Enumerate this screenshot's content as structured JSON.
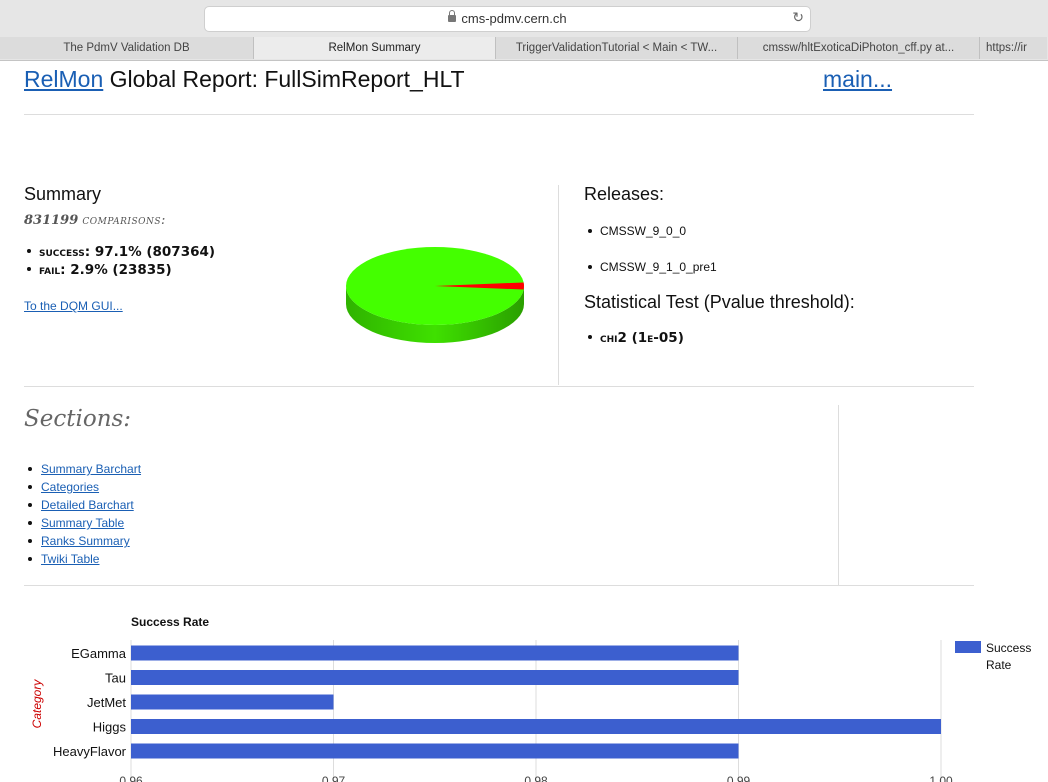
{
  "browser": {
    "url": "cms-pdmv.cern.ch",
    "tabs": [
      {
        "label": "The PdmV Validation DB"
      },
      {
        "label": "RelMon Summary"
      },
      {
        "label": "TriggerValidationTutorial < Main < TW..."
      },
      {
        "label": "cmssw/hltExoticaDiPhoton_cff.py at..."
      },
      {
        "label": "https://ir"
      }
    ]
  },
  "header": {
    "relmon_link": "RelMon",
    "title_rest": " Global Report: FullSimReport_HLT",
    "main_link": "main..."
  },
  "summary": {
    "heading": "Summary",
    "comparisons_count": "831199",
    "comparisons_label": "comparisons:",
    "success_label": "success:",
    "success_value": "97.1% (807364)",
    "fail_label": "fail:",
    "fail_value": "2.9% (23835)",
    "dqm_link": "To the DQM GUI...",
    "pie": {
      "success_fraction": 0.971,
      "fail_fraction": 0.029,
      "success_color": "#44ff00",
      "fail_color": "#ff0000"
    }
  },
  "releases": {
    "heading": "Releases:",
    "items": [
      "CMSSW_9_0_0",
      "CMSSW_9_1_0_pre1"
    ],
    "stat_heading": "Statistical Test (Pvalue threshold):",
    "stat_test_name": "chi2",
    "stat_test_value": " (1e-05)"
  },
  "sections": {
    "heading": "Sections:",
    "links": [
      "Summary Barchart",
      "Categories",
      "Detailed Barchart",
      "Summary Table",
      "Ranks Summary",
      "Twiki Table"
    ]
  },
  "chart_data": {
    "type": "bar",
    "orientation": "horizontal",
    "title": "Success Rate",
    "ylabel": "Category",
    "categories": [
      "EGamma",
      "Tau",
      "JetMet",
      "Higgs",
      "HeavyFlavor"
    ],
    "series": [
      {
        "name": "Success Rate",
        "values": [
          0.99,
          0.99,
          0.97,
          1.0,
          0.99
        ],
        "color": "#3c5fcf"
      }
    ],
    "xlim": [
      0.96,
      1.0
    ],
    "xticks": [
      "0.96",
      "0.97",
      "0.98",
      "0.99",
      "1.00"
    ],
    "legend_position": "right",
    "grid": true
  }
}
